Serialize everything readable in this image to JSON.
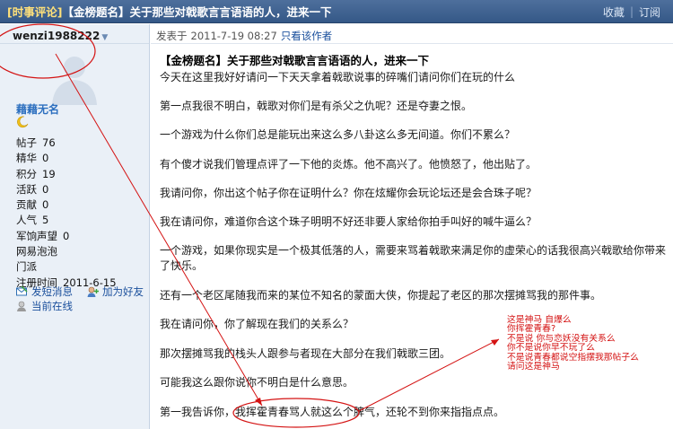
{
  "header": {
    "tag": "[时事评论]",
    "title": "【金榜题名】关于那些对戟歌言言语语的人，进来一下",
    "collect": "收藏",
    "separator": "|",
    "subscribe": "订阅"
  },
  "user": {
    "username": "wenzi1988222",
    "nickname": "藉藉无名",
    "stats": [
      {
        "label": "帖子",
        "value": "76"
      },
      {
        "label": "精华",
        "value": "0"
      },
      {
        "label": "积分",
        "value": "19"
      },
      {
        "label": "活跃",
        "value": "0"
      },
      {
        "label": "贡献",
        "value": "0"
      },
      {
        "label": "人气",
        "value": "5"
      },
      {
        "label": "军饷声望",
        "value": "0"
      }
    ],
    "bubble": "网易泡泡",
    "portal": "门派",
    "reg_label": "注册时间",
    "reg_date": "2011-6-15",
    "msg_link": "发短消息",
    "friend_link": "加为好友",
    "online_status": "当前在线"
  },
  "post": {
    "meta_prefix": "发表于",
    "date": "2011-7-19 08:27",
    "only_author": "只看该作者",
    "title": "【金榜题名】关于那些对戟歌言言语语的人，进来一下",
    "paragraphs": [
      "今天在这里我好好请问一下天天拿着戟歌说事的碎嘴们请问你们在玩的什么",
      "第一点我很不明白，戟歌对你们是有杀父之仇呢？还是夺妻之恨。",
      "一个游戏为什么你们总是能玩出来这么多八卦这么多无间道。你们不累么？",
      "有个傻才说我们管理点评了一下他的炎炼。他不高兴了。他愤怒了，他出贴了。",
      "我请问你，你出这个帖子你在证明什么？你在炫耀你会玩论坛还是会合珠子呢？",
      "我在请问你，难道你合这个珠子明明不好还非要人家给你拍手叫好的喊牛逼么？",
      "一个游戏，如果你现实是一个极其低落的人，需要来骂着戟歌来满足你的虚荣心的话我很高兴戟歌给你带来了快乐。",
      "还有一个老区尾随我而来的某位不知名的蒙面大侠，你提起了老区的那次摆摊骂我的那件事。",
      "我在请问你，你了解现在我们的关系么？",
      "那次摆摊骂我的栈头人跟参与者现在大部分在我们戟歌三团。",
      "可能我这么跟你说你不明白是什么意思。",
      "第一我告诉你，我挥霍青春骂人就这么个脾气，还轮不到你来指指点点。"
    ]
  },
  "annotation": {
    "lines": [
      "这是神马  自爆么",
      "你挥霍青春?",
      "不是说  你与恋妖没有关系么",
      "你不是说你早不玩了么",
      "不是说青春都说空指摆我那帖子么",
      "请问这是神马"
    ]
  }
}
